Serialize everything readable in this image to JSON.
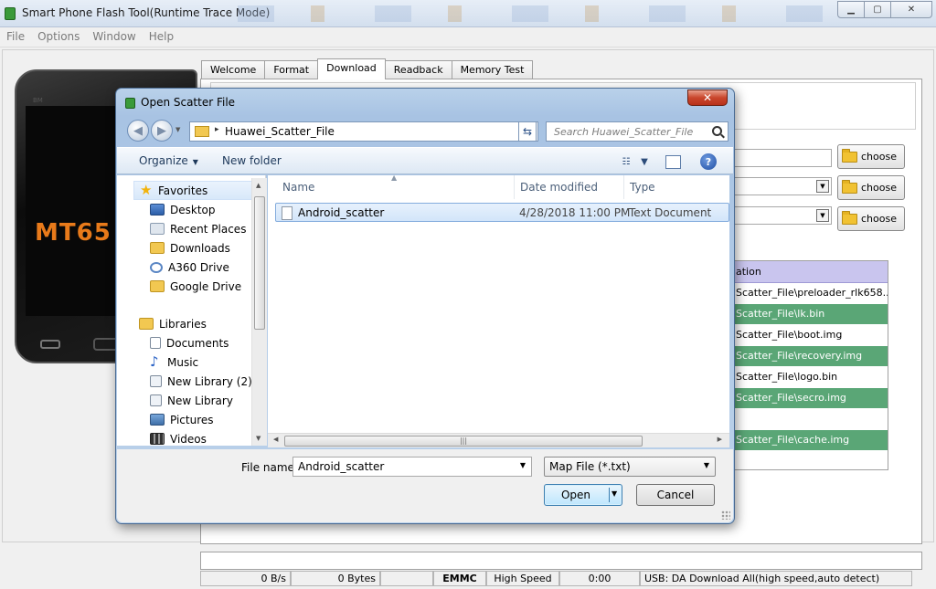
{
  "window": {
    "title": "Smart Phone Flash Tool(Runtime Trace Mode)"
  },
  "menu": [
    "File",
    "Options",
    "Window",
    "Help"
  ],
  "phone": {
    "brand": "MT65"
  },
  "tabs": [
    "Welcome",
    "Format",
    "Download",
    "Readback",
    "Memory Test"
  ],
  "active_tab": "Download",
  "choose_buttons": [
    "choose",
    "choose",
    "choose"
  ],
  "partition_table": {
    "header": "ation",
    "rows": [
      {
        "location": "Scatter_File\\preloader_rlk658...",
        "highlight": false
      },
      {
        "location": "Scatter_File\\lk.bin",
        "highlight": true
      },
      {
        "location": "Scatter_File\\boot.img",
        "highlight": false
      },
      {
        "location": "Scatter_File\\recovery.img",
        "highlight": true
      },
      {
        "location": "Scatter_File\\logo.bin",
        "highlight": false
      },
      {
        "location": "Scatter_File\\secro.img",
        "highlight": true
      },
      {
        "location": "",
        "highlight": false
      },
      {
        "location": "Scatter_File\\cache.img",
        "highlight": true
      }
    ],
    "highlight_color": "#5aa676"
  },
  "status_bar": {
    "speed": "0 B/s",
    "bytes": "0 Bytes",
    "storage": "EMMC",
    "mode": "High Speed",
    "time": "0:00",
    "usb": "USB: DA Download All(high speed,auto detect)"
  },
  "dialog": {
    "title": "Open Scatter File",
    "close_label": "✕",
    "address": {
      "path": "Huawei_Scatter_File",
      "separator": "▸"
    },
    "search": {
      "placeholder": "Search Huawei_Scatter_File"
    },
    "toolbar": {
      "organize": "Organize",
      "new_folder": "New folder"
    },
    "nav": {
      "favorites_header": "Favorites",
      "favorites": [
        "Desktop",
        "Recent Places",
        "Downloads",
        "A360 Drive",
        "Google Drive"
      ],
      "libraries_header": "Libraries",
      "libraries": [
        "Documents",
        "Music",
        "New Library (2)",
        "New Library",
        "Pictures",
        "Videos"
      ]
    },
    "columns": {
      "name": "Name",
      "date": "Date modified",
      "type": "Type"
    },
    "files": [
      {
        "name": "Android_scatter",
        "date": "4/28/2018 11:00 PM",
        "type": "Text Document"
      }
    ],
    "file_name_label": "File name:",
    "file_name_value": "Android_scatter",
    "filter": "Map File (*.txt)",
    "open_label": "Open",
    "cancel_label": "Cancel"
  }
}
